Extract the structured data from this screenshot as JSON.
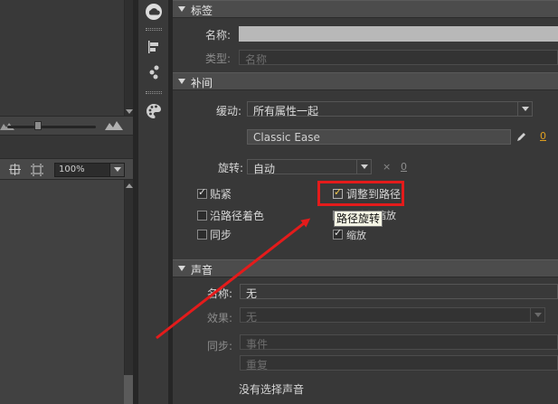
{
  "zoom": {
    "value": "100%"
  },
  "props": {
    "label_section": {
      "title": "标签",
      "name_label": "名称:",
      "type_label": "类型:",
      "type_value": "名称"
    },
    "tween_section": {
      "title": "补间",
      "ease_label": "缓动:",
      "ease_value": "所有属性一起",
      "ease_preset": "Classic Ease",
      "ease_amount": "0",
      "rotate_label": "旋转:",
      "rotate_value": "自动",
      "rotate_times_symbol": "×",
      "rotate_count": "0",
      "snap_label": "贴紧",
      "orient_label": "调整到路径",
      "path_color_label": "沿路径着色",
      "path_scale_label": "沿路径缩放",
      "sync_label": "同步",
      "scale_label": "缩放",
      "tooltip": "路径旋转"
    },
    "sound_section": {
      "title": "声音",
      "name_label": "名称:",
      "name_value": "无",
      "effect_label": "效果:",
      "effect_value": "无",
      "sync_label": "同步:",
      "sync_value": "事件",
      "repeat_value": "重复",
      "status": "没有选择声音"
    }
  },
  "colors": {
    "annotation": "#e41b1b",
    "accent": "#e0a020"
  }
}
